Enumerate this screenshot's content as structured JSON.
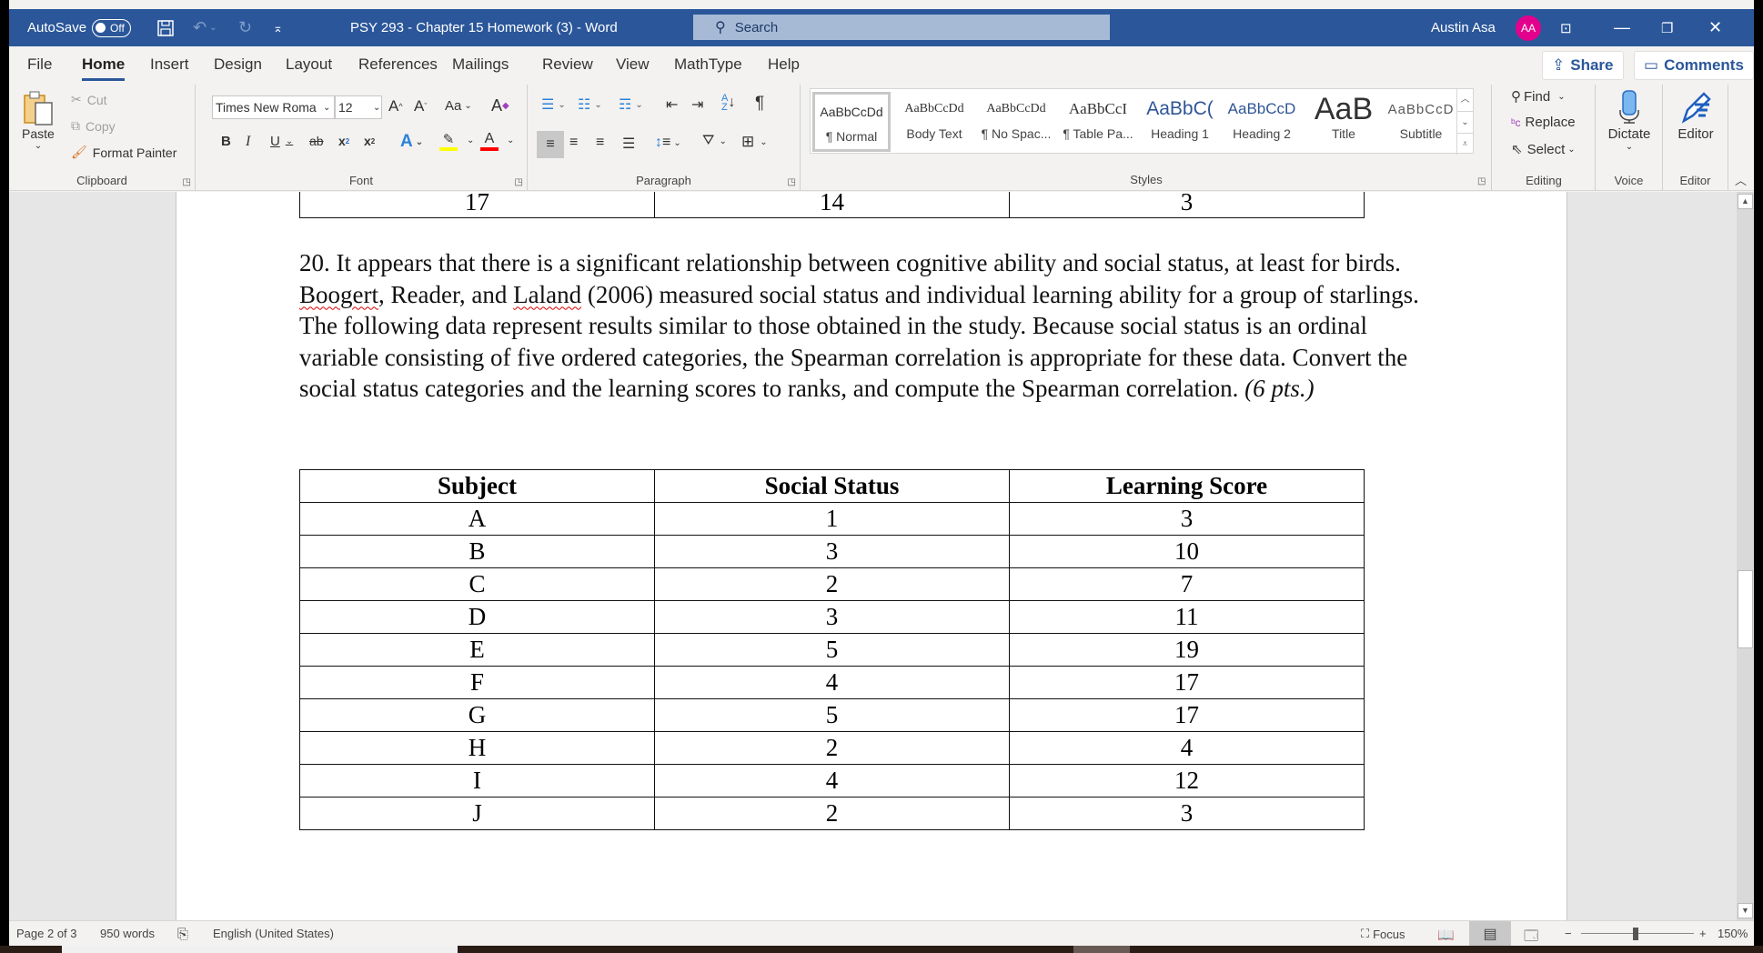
{
  "titlebar": {
    "autosave_label": "AutoSave",
    "autosave_state": "Off",
    "document_title": "PSY 293 - Chapter 15 Homework (3)  -  Word",
    "search_placeholder": "Search",
    "user_name": "Austin Asa",
    "user_initials": "AA",
    "avatar_color": "#e3008c",
    "brand_color": "#2b579a"
  },
  "tabs": [
    {
      "label": "File"
    },
    {
      "label": "Home",
      "active": true
    },
    {
      "label": "Insert"
    },
    {
      "label": "Design"
    },
    {
      "label": "Layout"
    },
    {
      "label": "References"
    },
    {
      "label": "Mailings"
    },
    {
      "label": "Review"
    },
    {
      "label": "View"
    },
    {
      "label": "MathType"
    },
    {
      "label": "Help"
    }
  ],
  "header_buttons": {
    "share": "Share",
    "comments": "Comments"
  },
  "ribbon": {
    "clipboard": {
      "paste": "Paste",
      "cut": "Cut",
      "copy": "Copy",
      "format_painter": "Format Painter",
      "label": "Clipboard"
    },
    "font": {
      "font_name": "Times New Roma",
      "font_size": "12",
      "change_case": "Aa",
      "label": "Font"
    },
    "paragraph": {
      "label": "Paragraph"
    },
    "styles": {
      "label": "Styles",
      "items": [
        {
          "preview": "AaBbCcDd",
          "name": "¶ Normal"
        },
        {
          "preview": "AaBbCcDd",
          "name": "Body Text"
        },
        {
          "preview": "AaBbCcDd",
          "name": "¶ No Spac..."
        },
        {
          "preview": "AaBbCcI",
          "name": "¶ Table Pa..."
        },
        {
          "preview": "AaBbC(",
          "name": "Heading 1"
        },
        {
          "preview": "AaBbCcD",
          "name": "Heading 2"
        },
        {
          "preview": "AaB",
          "name": "Title"
        },
        {
          "preview": "AaBbCcD",
          "name": "Subtitle"
        }
      ]
    },
    "editing": {
      "find": "Find",
      "replace": "Replace",
      "select": "Select",
      "label": "Editing"
    },
    "voice": {
      "dictate": "Dictate",
      "label": "Voice"
    },
    "editor": {
      "editor": "Editor",
      "label": "Editor"
    }
  },
  "document": {
    "previous_table_row": [
      "17",
      "14",
      "3"
    ],
    "question": {
      "part1": "20. It appears that there is a significant relationship between cognitive ability and social status, at least for birds. ",
      "author1": "Boogert",
      "part2": ", Reader, and ",
      "author3": "Laland",
      "part3": " (2006) measured social status and individual learning ability for a group of starlings. The following data represent results similar to those obtained in the study. Because social status is an ordinal variable consisting of five ordered categories, the Spearman correlation is appropriate for these data. Convert the social status categories and the learning scores to ranks, and compute the Spearman correlation. ",
      "points": "(6 pts.)"
    },
    "table": {
      "headers": [
        "Subject",
        "Social Status",
        "Learning Score"
      ],
      "rows": [
        [
          "A",
          "1",
          "3"
        ],
        [
          "B",
          "3",
          "10"
        ],
        [
          "C",
          "2",
          "7"
        ],
        [
          "D",
          "3",
          "11"
        ],
        [
          "E",
          "5",
          "19"
        ],
        [
          "F",
          "4",
          "17"
        ],
        [
          "G",
          "5",
          "17"
        ],
        [
          "H",
          "2",
          "4"
        ],
        [
          "I",
          "4",
          "12"
        ],
        [
          "J",
          "2",
          "3"
        ]
      ]
    }
  },
  "statusbar": {
    "page": "Page 2 of 3",
    "words": "950 words",
    "language": "English (United States)",
    "focus": "Focus",
    "zoom": "150%"
  }
}
